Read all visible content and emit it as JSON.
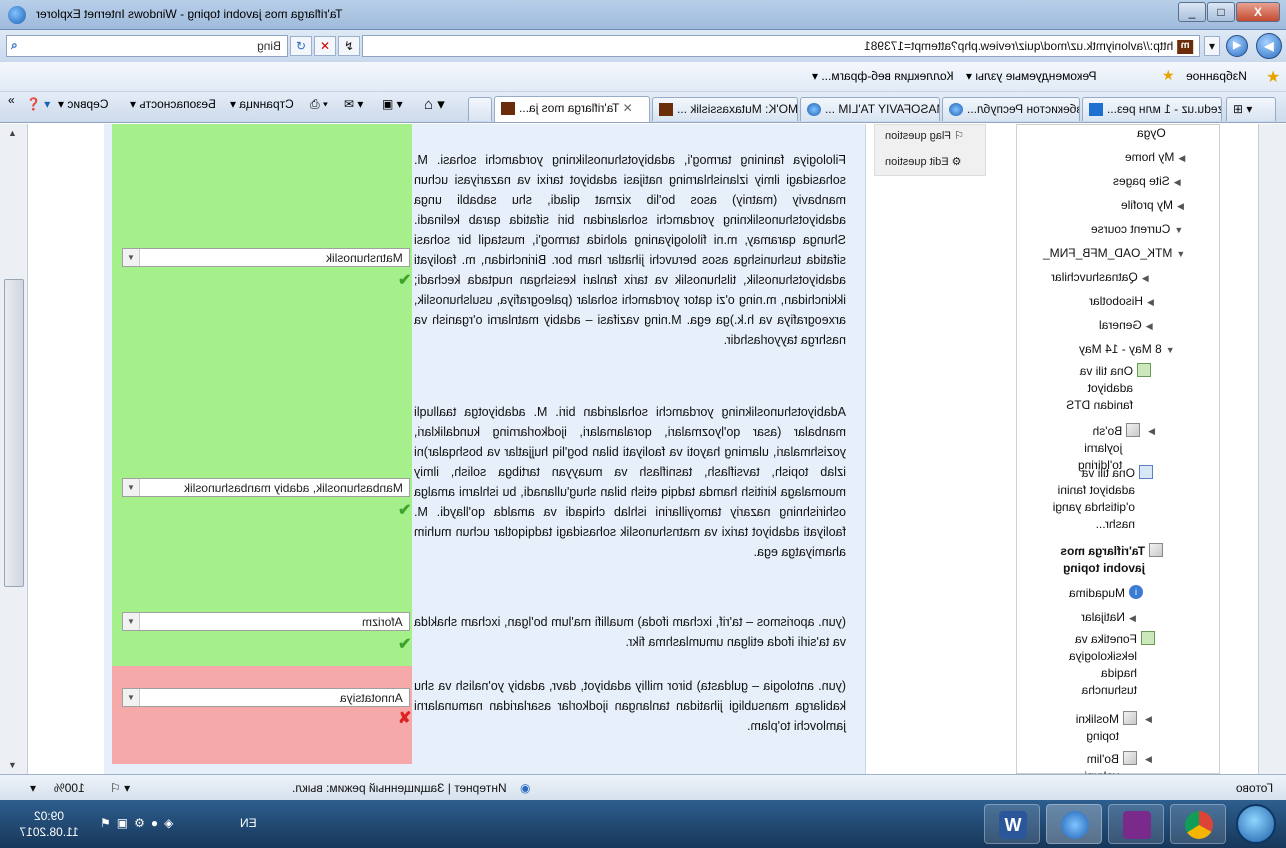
{
  "window": {
    "title": "Ta'riflarga mos javobni toping - Windows Internet Explorer",
    "ghost_title": "Ta'riflarga mos javobni toping - Windows Internet Explorer"
  },
  "address": {
    "url": "http://avloniymtk.uz/mod/quiz/review.php?attempt=173981",
    "search_placeholder": "Bing"
  },
  "favorites": {
    "label": "Избранное",
    "items": [
      "Рекомендуемые узлы ▾",
      "Коллекция веб-фрагм... ▾"
    ]
  },
  "tabs": [
    {
      "label": "uzedu.uz - 1 млн рез...",
      "icon": "bing-icon",
      "active": false
    },
    {
      "label": "Узбекистон Республ...",
      "icon": "ie-icon",
      "active": false
    },
    {
      "label": "MASOFAVIY TA'LIM ...",
      "icon": "ie-icon",
      "active": false
    },
    {
      "label": "MO'K: Mutaxassislik ...",
      "icon": "moodle-icon",
      "active": false
    },
    {
      "label": "Ta'riflarga mos ja...",
      "icon": "moodle-icon",
      "active": true
    }
  ],
  "command_bar": {
    "page": "Страница ▾",
    "safety": "Безопасность ▾",
    "tools": "Сервис ▾"
  },
  "questions": [
    {
      "text": "Filologiya fanining tarmog'i, adabiyotshunoslikning yordamchi sohasi. M. sohasidagi ilmiy izlanishlarning natijasi adabiyot tarixi va nazariyasi uchun manbaviy (matniy) asos bo'lib xizmat qiladi, shu sababli unga adabiyotshunoslikning yordamchi sohalaridan biri sifatida qarab kelinadi. Shunga qaramay, m.ni filologiyaning alohida tarmog'i, mustaqil bir sohasi sifatida tushunishga asos beruvchi jihatlar ham bor. Birinchidan, m. faoliyati adabiyotshunoslik, tilshunoslik va tarix fanlari kesishgan nuqtada kechadi; ikkinchidan, m.ning o'zi qator yordamchi sohalar (paleografiya, usulshunoslik, arxeografiya va h.k.)ga ega. M.ning vazifasi – adabiy matnlarni o'rganish va nashrga tayyorlashdir.",
      "answer": "Matnshunoslik",
      "correct": true
    },
    {
      "text": "Adabiyotshunoslikning yordamchi sohalaridan biri. M. adabiyotga taalluqli manbalar (asar qo'lyozmalari, qoralamalari, ijodkorlarning kundaliklari, yozishmalari, ularning hayoti va faoliyati bilan bog'liq hujjatlar va boshqalar)ni izlab topish, tavsiflash, tasniflash va muayyan tartibga solish, ilmiy muomalaga kiritish hamda tadqiq etish bilan shug'ullanadi, bu ishlarni amalga oshirishning nazariy tamoyillarini ishlab chiqadi va amalda qo'llaydi. M. faoliyati adabiyot tarixi va matnshunoslik sohasidagi tadqiqotlar uchun muhim ahamiyatga ega.",
      "answer": "Manbashunoslik, adabiy manbashunoslik",
      "correct": true
    },
    {
      "text": "(yun. aporismos – ta'rif, ixcham ifoda) muallifi ma'lum bo'lgan, ixcham shaklda va ta'sirli ifoda etilgan umumlashma fikr.",
      "answer": "Aforizm",
      "correct": true
    },
    {
      "text": "(yun. antologia – guldasta) biror milliy adabiyot, davr, adabiy yo'nalish va shu kabilarga mansubligi jihatidan tanlangan ijodkorlar asarlaridan namunalarni jamlovchi to'plam.",
      "answer": "Annotatsiya",
      "correct": false
    }
  ],
  "question_info": {
    "flag": "Flag question",
    "edit": "Edit question"
  },
  "nav": {
    "top_cut": "Oyga",
    "items": [
      "My home",
      "Site pages",
      "My profile",
      "Current course",
      "MTK_OAD_MFB_FNM_",
      "Qatnashuvchilar",
      "Hisobotlar",
      "General",
      "8 May - 14 May",
      "Ona tili va adabiyot fanidan DTS",
      "Bo'sh joylarni to'ldiring",
      "Ona tili va adabiyot fanini o'qitishda yangi nashr...",
      "Ta'riflarga mos javobni toping",
      "Muqadima",
      "Natijalar",
      "Fonetika va leksikologiya haqida tushuncha",
      "Moslikni toping",
      "Bo'lim yakuni"
    ]
  },
  "status": {
    "left": "Готово",
    "zone": "Интернет | Защищенный режим: выкл.",
    "zoom": "100%"
  },
  "taskbar": {
    "time": "09:02",
    "date": "11.08.2017",
    "lang": "EN"
  }
}
